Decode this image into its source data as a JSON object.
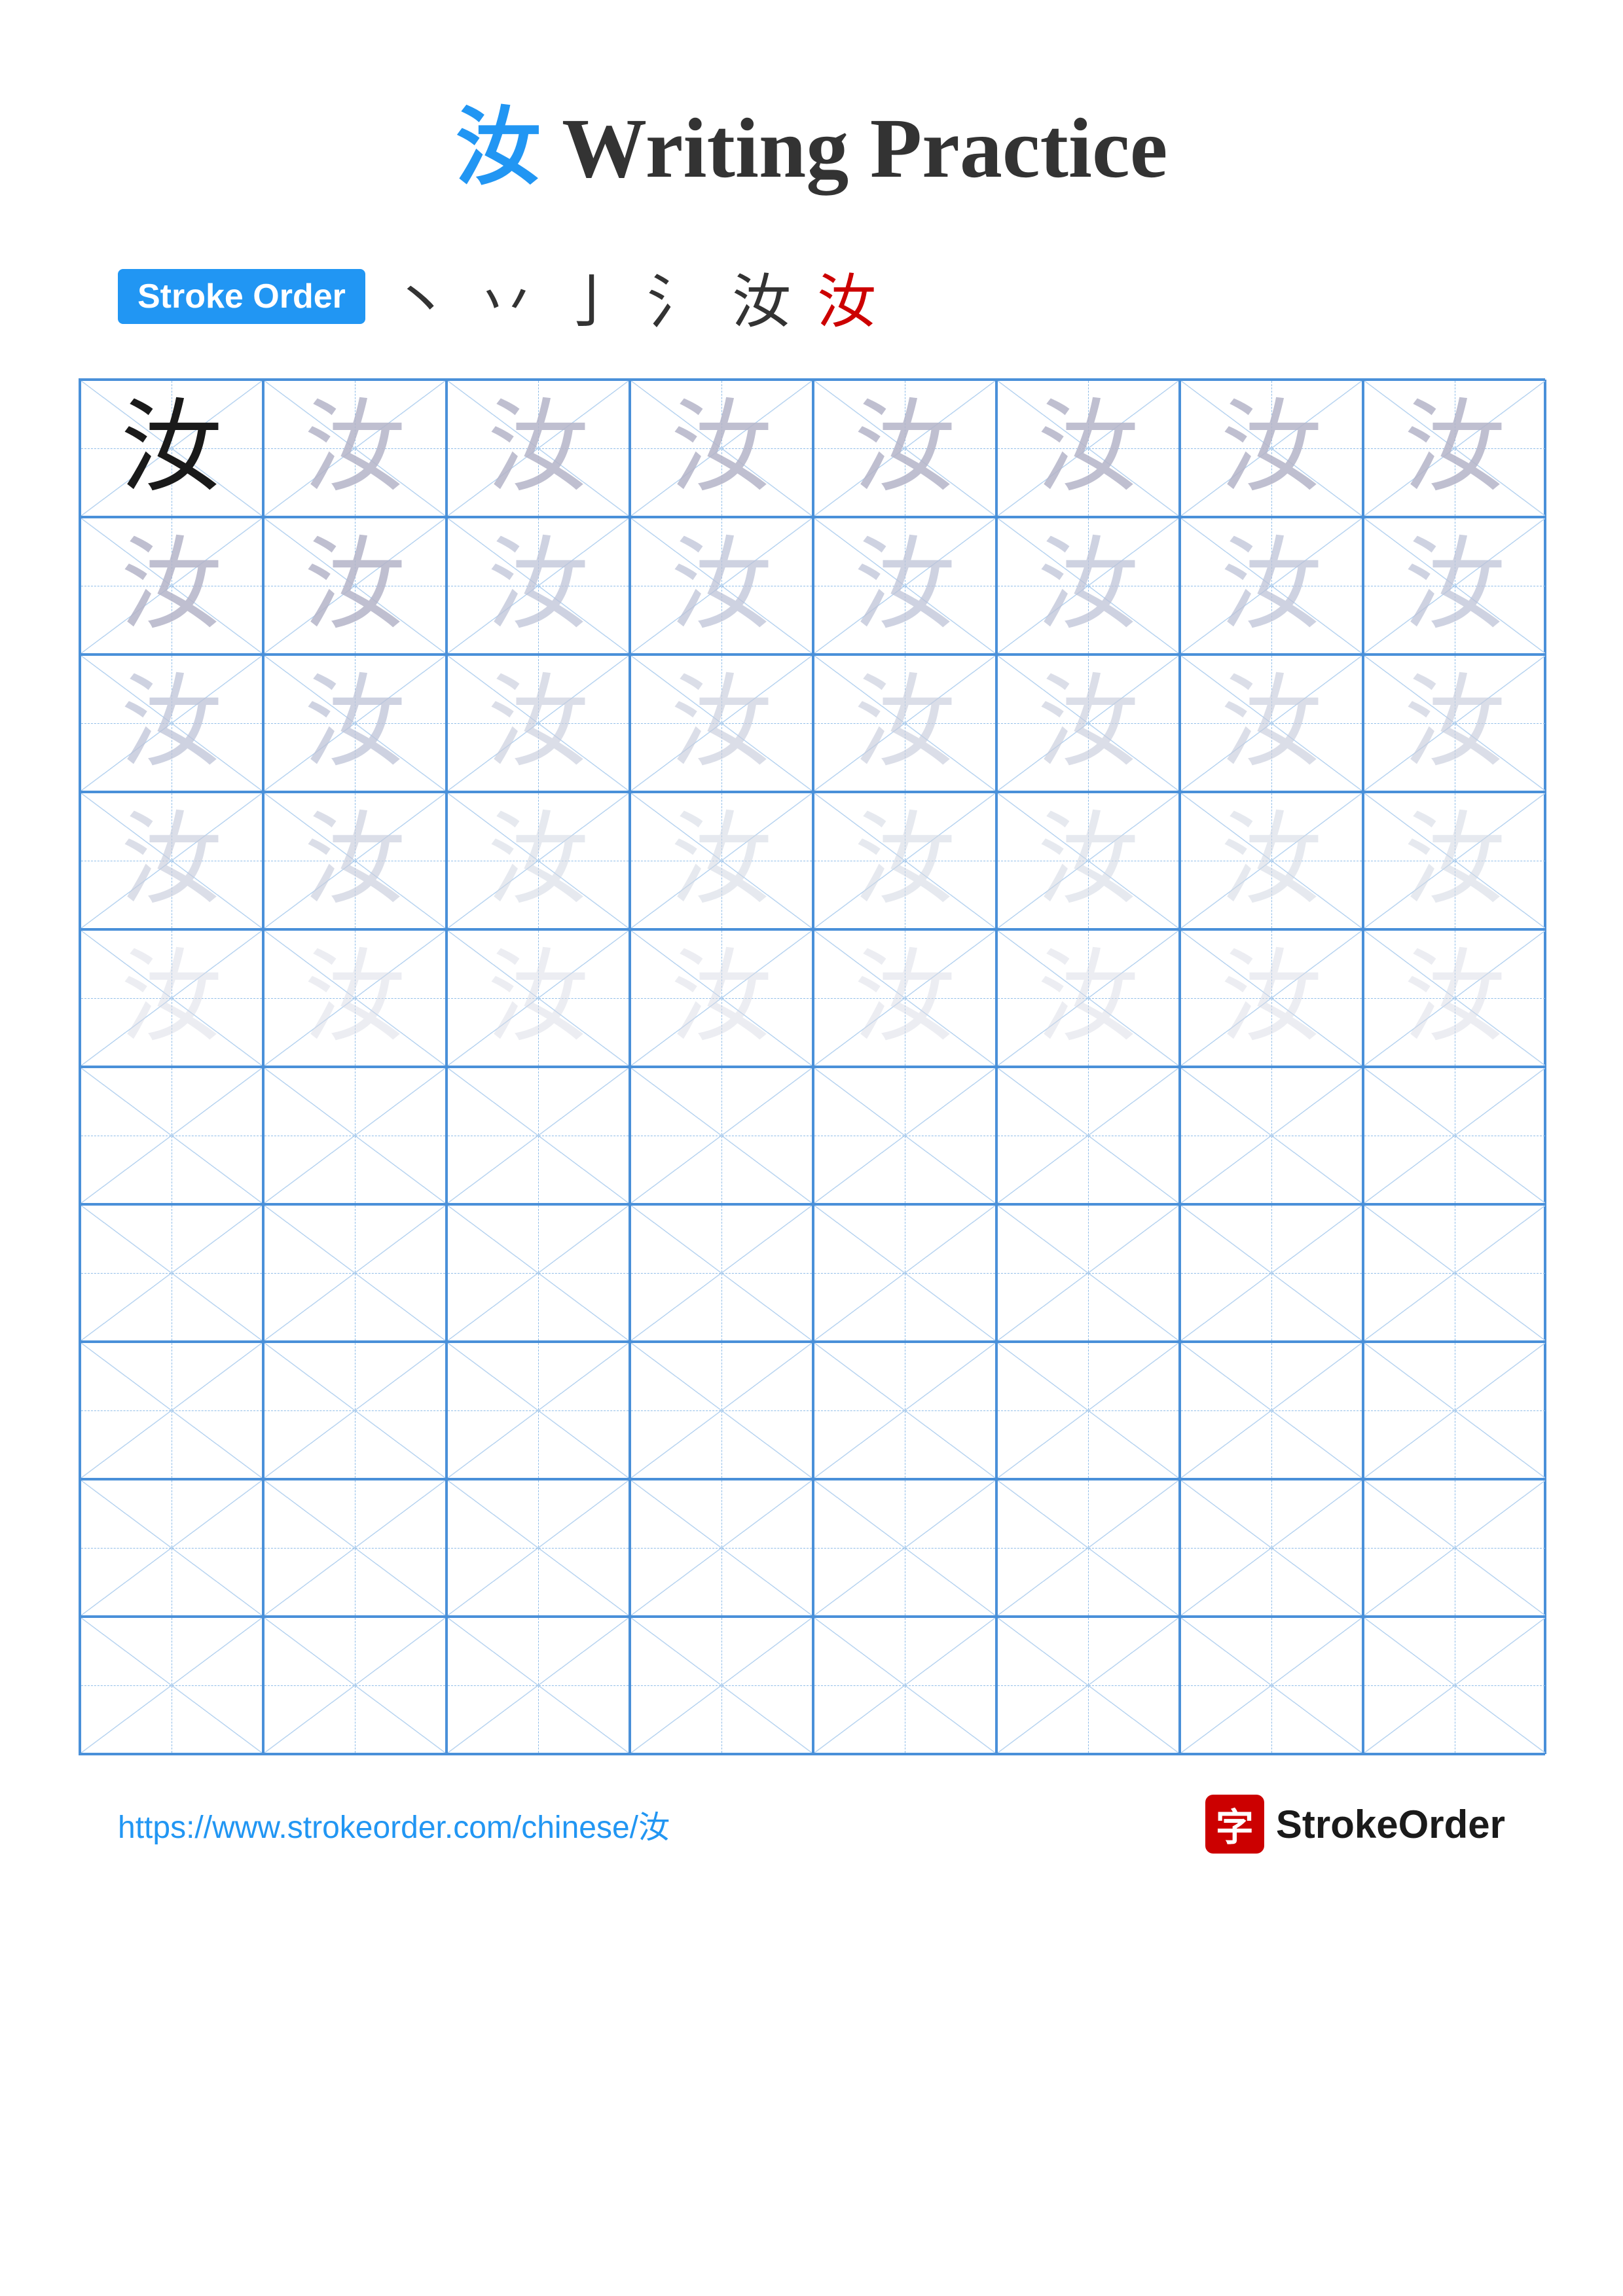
{
  "title": {
    "char": "汝",
    "text": " Writing Practice"
  },
  "stroke_order": {
    "badge_label": "Stroke Order",
    "sequence": [
      "丶",
      "丷",
      "亅",
      "氵",
      "汝",
      "汝"
    ]
  },
  "grid": {
    "rows": 10,
    "cols": 8,
    "character": "汝",
    "filled_rows": 5,
    "empty_rows": 5
  },
  "footer": {
    "url": "https://www.strokeorder.com/chinese/汝",
    "logo_icon": "字",
    "logo_text": "StrokeOrder"
  }
}
